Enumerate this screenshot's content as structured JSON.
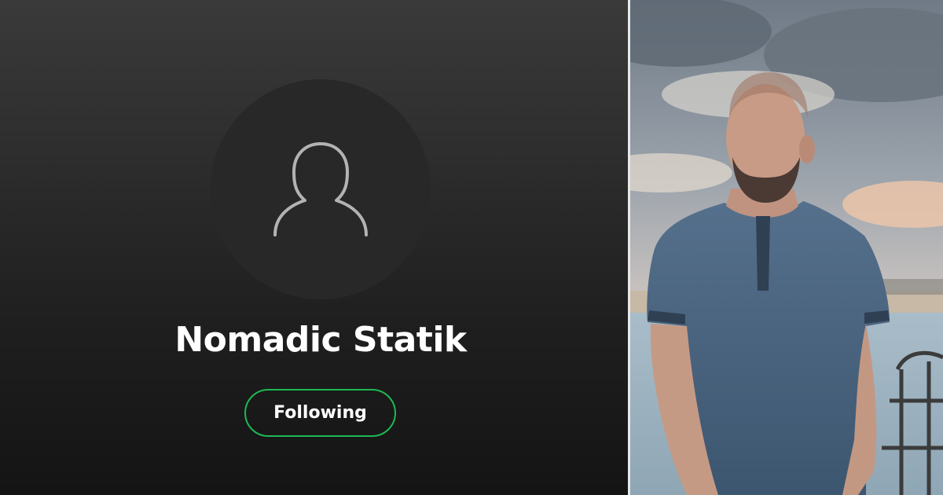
{
  "profile": {
    "name": "Nomadic Statik",
    "follow_button_label": "Following",
    "avatar_icon": "user-placeholder-icon"
  },
  "photo": {
    "subject": "man-in-blue-shirt-at-seaside-photo"
  },
  "colors": {
    "accent_green": "#1db954",
    "avatar_bg": "#282828",
    "icon_stroke": "#b3b3b3"
  }
}
